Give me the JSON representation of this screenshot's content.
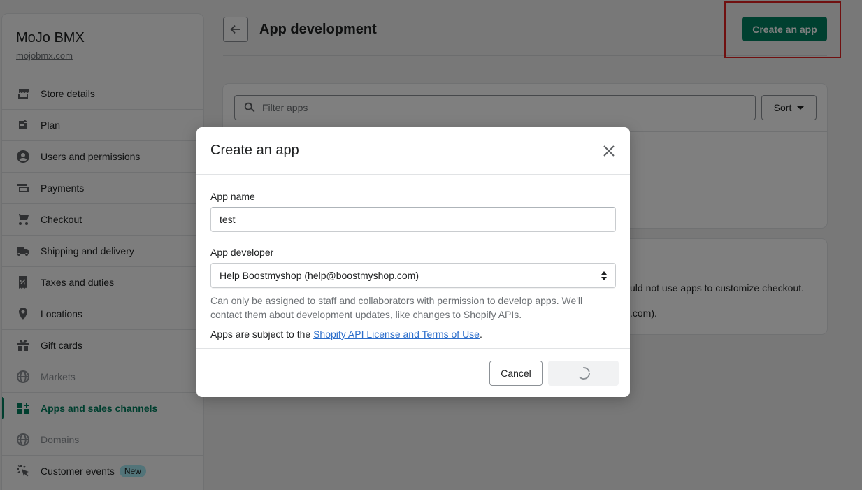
{
  "store": {
    "name": "MoJo BMX",
    "url": "mojobmx.com"
  },
  "sidebar": {
    "items": [
      {
        "label": "Store details",
        "icon": "store-icon",
        "state": "normal"
      },
      {
        "label": "Plan",
        "icon": "plan-icon",
        "state": "normal"
      },
      {
        "label": "Users and permissions",
        "icon": "user-icon",
        "state": "normal"
      },
      {
        "label": "Payments",
        "icon": "payments-icon",
        "state": "normal"
      },
      {
        "label": "Checkout",
        "icon": "cart-icon",
        "state": "normal"
      },
      {
        "label": "Shipping and delivery",
        "icon": "truck-icon",
        "state": "normal"
      },
      {
        "label": "Taxes and duties",
        "icon": "tax-icon",
        "state": "normal"
      },
      {
        "label": "Locations",
        "icon": "location-pin-icon",
        "state": "normal"
      },
      {
        "label": "Gift cards",
        "icon": "gift-icon",
        "state": "normal"
      },
      {
        "label": "Markets",
        "icon": "globe-icon",
        "state": "disabled"
      },
      {
        "label": "Apps and sales channels",
        "icon": "apps-icon",
        "state": "active"
      },
      {
        "label": "Domains",
        "icon": "globe-icon",
        "state": "disabled"
      },
      {
        "label": "Customer events",
        "icon": "cursor-click-icon",
        "state": "normal",
        "badge": "New"
      }
    ]
  },
  "header": {
    "title": "App development",
    "create_label": "Create an app"
  },
  "apps_card": {
    "filter_placeholder": "Filter apps",
    "sort_label": "Sort"
  },
  "info_card": {
    "line1": "uld not use apps to customize checkout.",
    "line2": ".com)."
  },
  "modal": {
    "title": "Create an app",
    "app_name_label": "App name",
    "app_name_value": "test",
    "app_developer_label": "App developer",
    "app_developer_value": "Help Boostmyshop (help@boostmyshop.com)",
    "help_text": "Can only be assigned to staff and collaborators with permission to develop apps. We'll contact them about development updates, like changes to Shopify APIs.",
    "terms_prefix": "Apps are subject to the ",
    "terms_link": "Shopify API License and Terms of Use",
    "terms_suffix": ".",
    "cancel_label": "Cancel"
  },
  "colors": {
    "primary": "#008060",
    "active_nav": "#007f5f",
    "link": "#2c6ecb",
    "highlight": "#e02020"
  }
}
